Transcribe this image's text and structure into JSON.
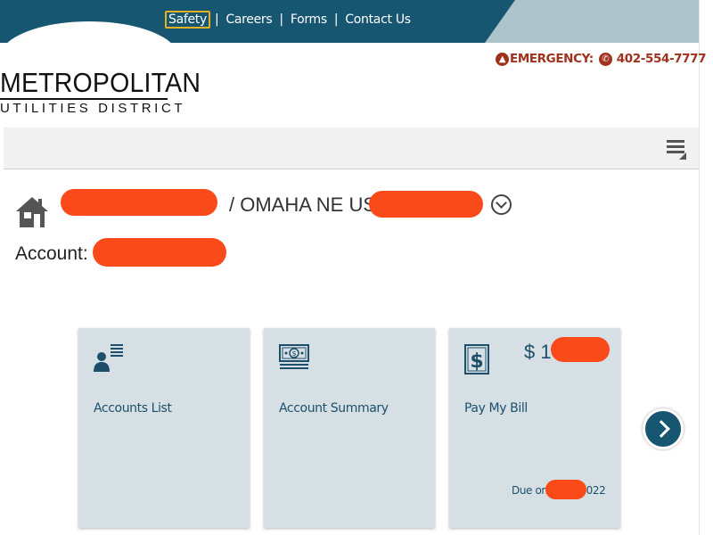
{
  "topnav": {
    "links": [
      {
        "label": "Safety"
      },
      {
        "label": "Careers"
      },
      {
        "label": "Forms"
      },
      {
        "label": "Contact Us"
      }
    ],
    "separator": "|"
  },
  "emergency": {
    "label": "EMERGENCY:",
    "phone": "402-554-7777"
  },
  "logo": {
    "line1": "METROPOLITAN",
    "line2": "UTILITIES DISTRICT"
  },
  "address": {
    "text": "/ OMAHA NE US"
  },
  "account": {
    "label": "Account:"
  },
  "cards": [
    {
      "label": "Accounts List",
      "icon": "user-list-icon"
    },
    {
      "label": "Account Summary",
      "icon": "money-icon"
    },
    {
      "label": "Pay My Bill",
      "icon": "dollar-bill-icon",
      "amount": "$ 1",
      "due_prefix": "Due on",
      "due_suffix": "022"
    }
  ],
  "colors": {
    "header": "#175670",
    "accent_yellow": "#e6b022",
    "emergency": "#a0311f",
    "card_bg": "#d6e0e4",
    "card_text": "#1d4f6b",
    "redaction": "#fa4a1a"
  }
}
